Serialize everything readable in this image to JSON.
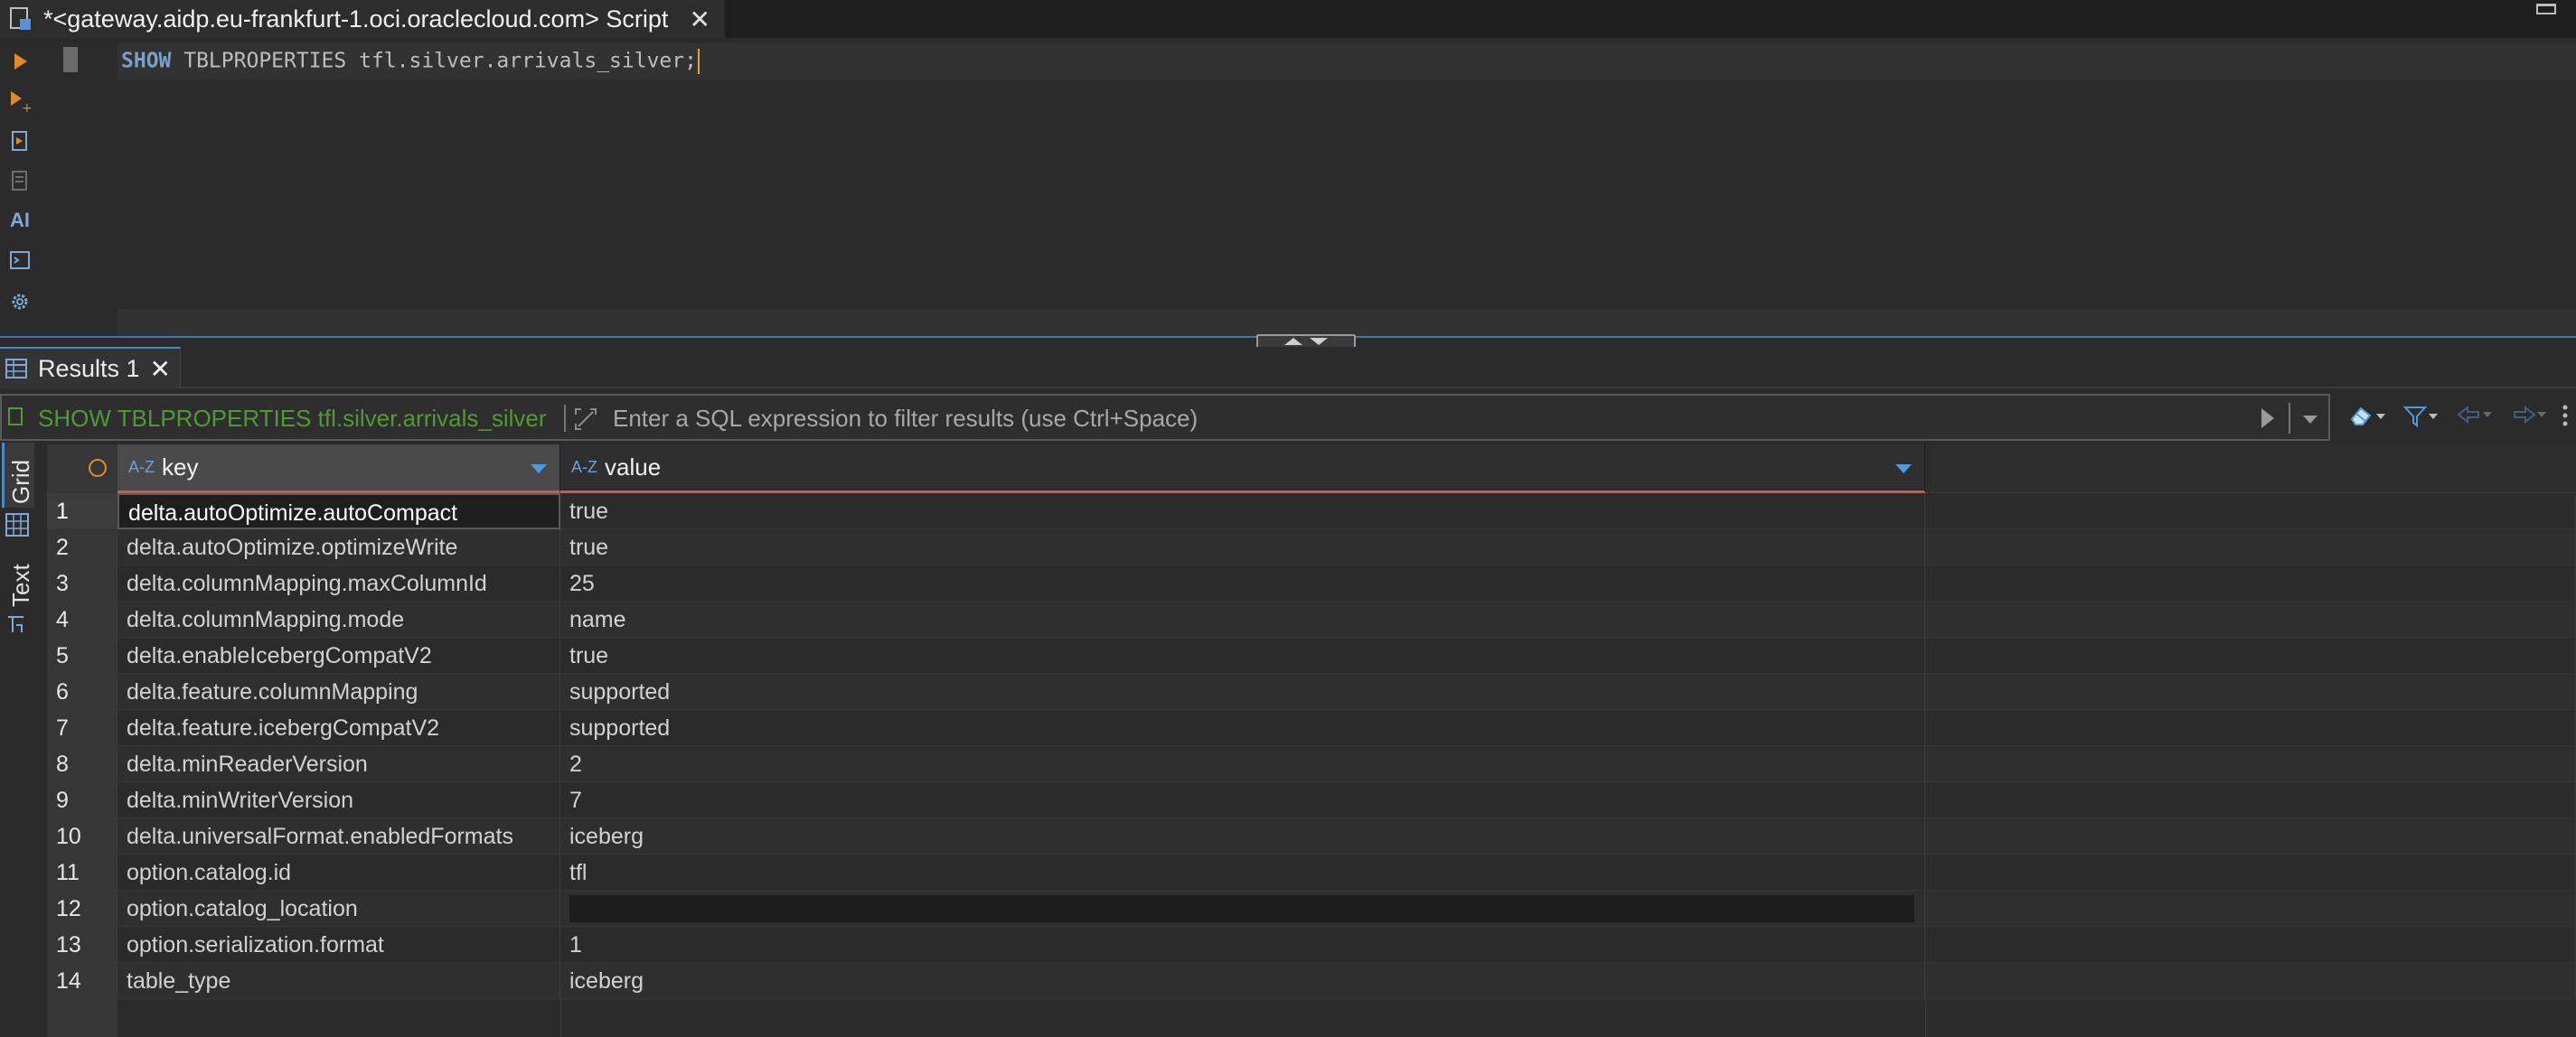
{
  "editor_tab": {
    "title": "*<gateway.aidp.eu-frankfurt-1.oci.oraclecloud.com> Script",
    "close": "✕"
  },
  "editor": {
    "sql": {
      "keyword": "SHOW",
      "rest": " TBLPROPERTIES tfl.silver.arrivals_silver;"
    },
    "toolbar_icons": [
      "execute-statement-icon",
      "execute-script-icon",
      "explain-plan-icon",
      "load-plan-icon",
      "ai-assistant-icon",
      "terminal-icon",
      "settings-icon"
    ],
    "ai_label": "AI"
  },
  "results_tab": {
    "label": "Results 1",
    "close": "✕"
  },
  "filter": {
    "query_label": "SHOW TBLPROPERTIES tfl.silver.arrivals_silver",
    "placeholder": "Enter a SQL expression to filter results (use Ctrl+Space)"
  },
  "side_tabs": {
    "grid": "Grid",
    "text": "Text"
  },
  "grid": {
    "columns": [
      {
        "sort_icon": "A-Z",
        "label": "key"
      },
      {
        "sort_icon": "A-Z",
        "label": "value"
      }
    ],
    "rows": [
      {
        "n": "1",
        "key": "delta.autoOptimize.autoCompact",
        "value": "true"
      },
      {
        "n": "2",
        "key": "delta.autoOptimize.optimizeWrite",
        "value": "true"
      },
      {
        "n": "3",
        "key": "delta.columnMapping.maxColumnId",
        "value": "25"
      },
      {
        "n": "4",
        "key": "delta.columnMapping.mode",
        "value": "name"
      },
      {
        "n": "5",
        "key": "delta.enableIcebergCompatV2",
        "value": "true"
      },
      {
        "n": "6",
        "key": "delta.feature.columnMapping",
        "value": "supported"
      },
      {
        "n": "7",
        "key": "delta.feature.icebergCompatV2",
        "value": "supported"
      },
      {
        "n": "8",
        "key": "delta.minReaderVersion",
        "value": "2"
      },
      {
        "n": "9",
        "key": "delta.minWriterVersion",
        "value": "7"
      },
      {
        "n": "10",
        "key": "delta.universalFormat.enabledFormats",
        "value": "iceberg"
      },
      {
        "n": "11",
        "key": "option.catalog.id",
        "value": "tfl"
      },
      {
        "n": "12",
        "key": "option.catalog_location",
        "value": ""
      },
      {
        "n": "13",
        "key": "option.serialization.format",
        "value": "1"
      },
      {
        "n": "14",
        "key": "table_type",
        "value": "iceberg"
      }
    ]
  },
  "colors": {
    "accent": "#4a88c7",
    "query_label": "#4f9a34",
    "caret": "#e3a33c",
    "header_underline": "#c85b4a"
  }
}
